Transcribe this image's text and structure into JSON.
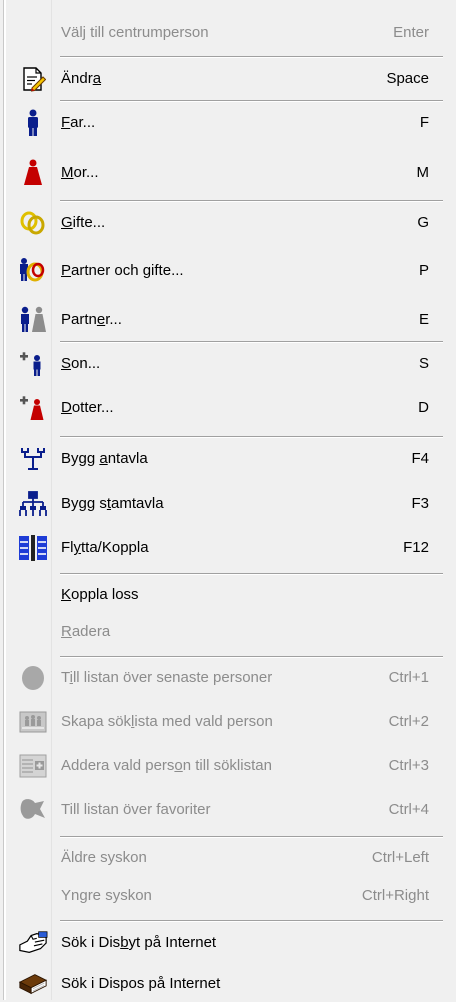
{
  "menu": {
    "items": [
      {
        "pre": "Välj till centrumperson",
        "acc": "",
        "post": "",
        "shortcut": "Enter",
        "disabled": true,
        "icon": ""
      },
      {
        "pre": "Ändr",
        "acc": "a",
        "post": "",
        "shortcut": "Space",
        "disabled": false,
        "icon": "edit-document-icon"
      },
      {
        "pre": "",
        "acc": "F",
        "post": "ar...",
        "shortcut": "F",
        "disabled": false,
        "icon": "father-icon"
      },
      {
        "pre": "",
        "acc": "M",
        "post": "or...",
        "shortcut": "M",
        "disabled": false,
        "icon": "mother-icon"
      },
      {
        "pre": "",
        "acc": "G",
        "post": "ifte...",
        "shortcut": "G",
        "disabled": false,
        "icon": "rings-icon"
      },
      {
        "pre": "",
        "acc": "P",
        "post": "artner och gifte...",
        "shortcut": "P",
        "disabled": false,
        "icon": "partner-rings-icon"
      },
      {
        "pre": "Partn",
        "acc": "e",
        "post": "r...",
        "shortcut": "E",
        "disabled": false,
        "icon": "partner-icon"
      },
      {
        "pre": "",
        "acc": "S",
        "post": "on...",
        "shortcut": "S",
        "disabled": false,
        "icon": "son-icon"
      },
      {
        "pre": "",
        "acc": "D",
        "post": "otter...",
        "shortcut": "D",
        "disabled": false,
        "icon": "daughter-icon"
      },
      {
        "pre": "Bygg ",
        "acc": "a",
        "post": "ntavla",
        "shortcut": "F4",
        "disabled": false,
        "icon": "ancestor-tree-icon"
      },
      {
        "pre": "Bygg s",
        "acc": "t",
        "post": "amtavla",
        "shortcut": "F3",
        "disabled": false,
        "icon": "descendant-tree-icon"
      },
      {
        "pre": "Fl",
        "acc": "y",
        "post": "tta/Koppla",
        "shortcut": "F12",
        "disabled": false,
        "icon": "move-link-icon"
      },
      {
        "pre": "",
        "acc": "K",
        "post": "oppla loss",
        "shortcut": "",
        "disabled": false,
        "icon": ""
      },
      {
        "pre": "",
        "acc": "R",
        "post": "adera",
        "shortcut": "",
        "disabled": true,
        "icon": ""
      },
      {
        "pre": "T",
        "acc": "i",
        "post": "ll listan över senaste personer",
        "shortcut": "Ctrl+1",
        "disabled": true,
        "icon": "recent-persons-icon"
      },
      {
        "pre": "Skapa sök",
        "acc": "l",
        "post": "ista med vald person",
        "shortcut": "Ctrl+2",
        "disabled": true,
        "icon": "create-search-list-icon"
      },
      {
        "pre": "Addera vald pers",
        "acc": "o",
        "post": "n till söklistan",
        "shortcut": "Ctrl+3",
        "disabled": true,
        "icon": "add-to-search-list-icon"
      },
      {
        "pre": "Till listan över favoriter",
        "acc": "",
        "post": "",
        "shortcut": "Ctrl+4",
        "disabled": true,
        "icon": "favorites-icon"
      },
      {
        "pre": "Äldre syskon",
        "acc": "",
        "post": "",
        "shortcut": "Ctrl+Left",
        "disabled": true,
        "icon": ""
      },
      {
        "pre": "Yngre syskon",
        "acc": "",
        "post": "",
        "shortcut": "Ctrl+Right",
        "disabled": true,
        "icon": ""
      },
      {
        "pre": "Sök i Dis",
        "acc": "b",
        "post": "yt på Internet",
        "shortcut": "",
        "disabled": false,
        "icon": "search-web-hand-icon"
      },
      {
        "pre": "Sök i Dispos på Internet",
        "acc": "",
        "post": "",
        "shortcut": "",
        "disabled": false,
        "icon": "book-icon"
      }
    ]
  }
}
